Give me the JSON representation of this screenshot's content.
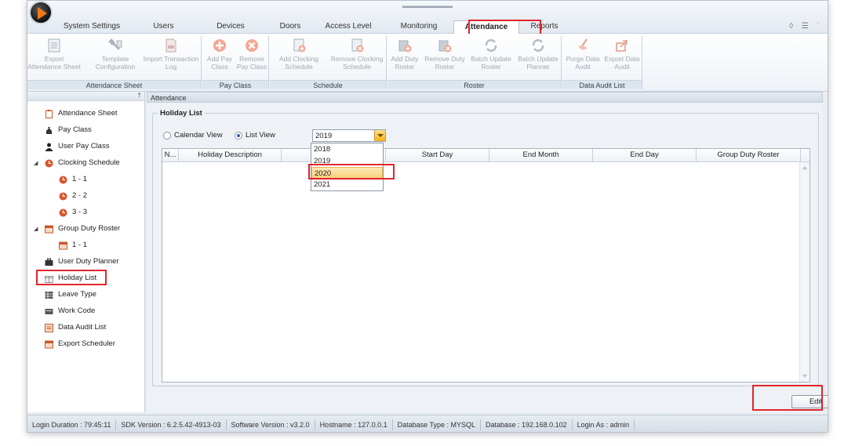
{
  "menu": {
    "tabs": [
      "System Settings",
      "Users",
      "Devices",
      "Doors",
      "Access Level",
      "Monitoring",
      "Attendance",
      "Reports"
    ],
    "active_tab": "Attendance"
  },
  "ribbon": {
    "groups": [
      {
        "label": "Attendance Sheet",
        "buttons": [
          "Export Attendance Sheet",
          "Template Configuration",
          "Import Transaction Log"
        ]
      },
      {
        "label": "Pay Class",
        "buttons": [
          "Add Pay Class",
          "Remove Pay Class"
        ]
      },
      {
        "label": "Schedule",
        "buttons": [
          "Add Clocking Schedule",
          "Remove Clocking Schedule"
        ]
      },
      {
        "label": "Roster",
        "buttons": [
          "Add Duty Roster",
          "Remove Duty Roster",
          "Batch Update Roster",
          "Batch Update Planner"
        ]
      },
      {
        "label": "Data Audit List",
        "buttons": [
          "Purge Data Audit",
          "Export Data Audit"
        ]
      }
    ]
  },
  "sidebar": {
    "items": [
      "Attendance Sheet",
      "Pay Class",
      "User Pay Class",
      "Clocking Schedule",
      "1 - 1",
      "2 - 2",
      "3 - 3",
      "Group Duty Roster",
      "1 - 1",
      "User Duty Planner",
      "Holiday List",
      "Leave Type",
      "Work Code",
      "Data Audit List",
      "Export Scheduler"
    ],
    "selected": "Holiday List"
  },
  "content": {
    "header": "Attendance",
    "group_title": "Holiday List",
    "view_calendar": "Calendar View",
    "view_list": "List View",
    "year_value": "2019",
    "year_options": [
      "2018",
      "2019",
      "2020",
      "2021"
    ],
    "highlighted_option": "2020",
    "columns": [
      "N...",
      "Holiday Description",
      "",
      "Start Day",
      "End Month",
      "End Day",
      "Group Duty Roster"
    ],
    "edit_label": "Edit"
  },
  "status": {
    "segments": [
      "Login Duration : 79:45:11",
      "SDK Version : 6.2.5.42-4913-03",
      "Software Version : v3.2.0",
      "Hostname : 127.0.0.1",
      "Database Type : MYSQL",
      "Database : 192.168.0.102",
      "Login As : admin"
    ]
  },
  "colors": {
    "highlight": "#e0252b",
    "accent_orange": "#f07a1a"
  }
}
